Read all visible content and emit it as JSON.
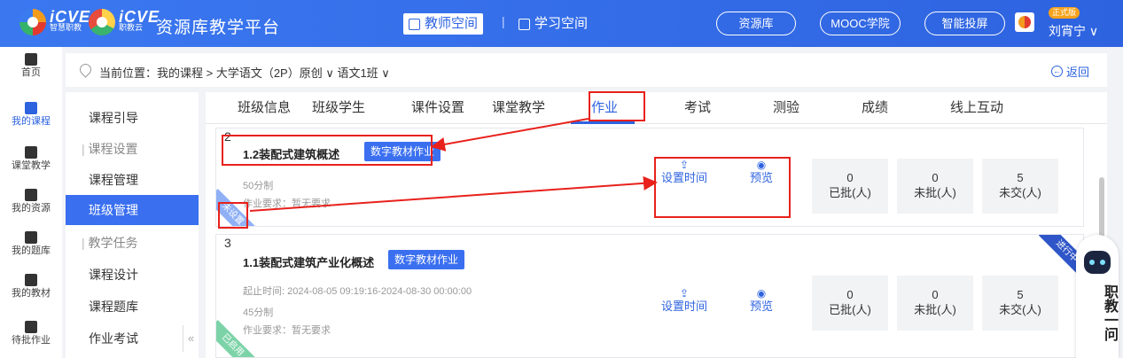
{
  "header": {
    "brand1_name": "iCVE",
    "brand1_sub": "智慧职教",
    "brand2_name": "iCVE",
    "brand2_sub": "职教云",
    "platform_title": "资源库教学平台",
    "teacher_space": "教师空间",
    "study_space": "学习空间",
    "sep": "|",
    "pills": [
      "资源库",
      "MOOC学院",
      "智能投屏"
    ],
    "version_badge": "正式版",
    "username": "刘宵宁 ∨"
  },
  "leftnav": [
    "首页",
    "我的课程",
    "课堂教学",
    "我的资源",
    "我的题库",
    "我的教材",
    "待批作业"
  ],
  "leftnav_active": "我的课程",
  "breadcrumb": {
    "text": "当前位置：我的课程 > 大学语文（2P）原创 ∨  语文1班 ∨",
    "back": "返回"
  },
  "subnav": [
    {
      "label": "课程引导",
      "type": "item"
    },
    {
      "label": "课程设置",
      "type": "group"
    },
    {
      "label": "课程管理",
      "type": "item"
    },
    {
      "label": "班级管理",
      "type": "item",
      "active": true
    },
    {
      "label": "教学任务",
      "type": "group"
    },
    {
      "label": "课程设计",
      "type": "item"
    },
    {
      "label": "课程题库",
      "type": "item"
    },
    {
      "label": "作业考试",
      "type": "item"
    }
  ],
  "tabs": [
    "班级信息",
    "班级学生",
    "课件设置",
    "课堂教学",
    "作业",
    "考试",
    "测验",
    "成绩",
    "线上互动"
  ],
  "active_tab": "作业",
  "cards": [
    {
      "index": "2",
      "title": "1.2装配式建筑概述",
      "tag": "数字教材作业",
      "time": "",
      "score": "50分制",
      "req": "作业要求：暂无要求",
      "status": "未设置",
      "approved": "0",
      "approved_label": "已批(人)",
      "unapproved": "0",
      "unapproved_label": "未批(人)",
      "unsubmitted": "5",
      "unsubmitted_label": "未交(人)"
    },
    {
      "index": "3",
      "title": "1.1装配式建筑产业化概述",
      "tag": "数字教材作业",
      "time": "起止时间: 2024-08-05 09:19:16-2024-08-30 00:00:00",
      "score": "45分制",
      "req": "作业要求：暂无要求",
      "status": "已启用",
      "running": "进行中",
      "approved": "0",
      "approved_label": "已批(人)",
      "unapproved": "0",
      "unapproved_label": "未批(人)",
      "unsubmitted": "5",
      "unsubmitted_label": "未交(人)"
    }
  ],
  "actions": {
    "set_time": "设置时间",
    "preview": "预览",
    "set_time_icon": "upload-box-icon",
    "preview_icon": "eye-icon"
  },
  "helper": {
    "text": "职教一问"
  },
  "colors": {
    "brand_blue": "#2e63e0",
    "tag_blue": "#3a6ff0",
    "highlight_red": "#e8211c"
  }
}
